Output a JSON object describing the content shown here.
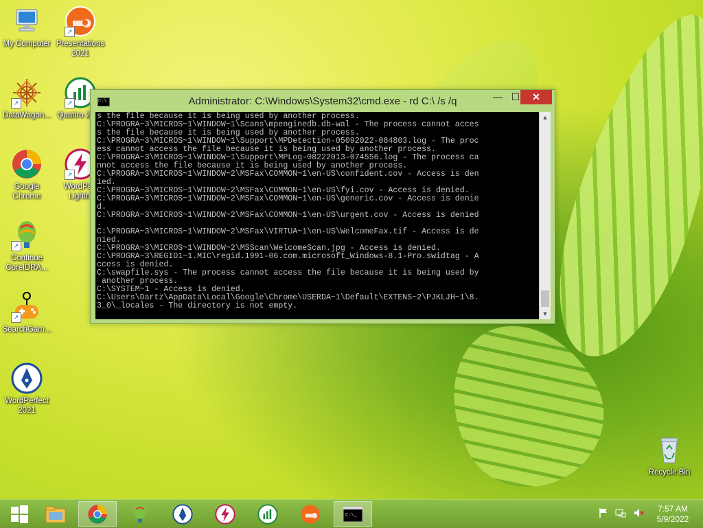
{
  "desktop": {
    "icons": [
      {
        "label": "My Computer"
      },
      {
        "label": "Presentations 2021"
      },
      {
        "label": "DataWagon..."
      },
      {
        "label": "Quattro 2021"
      },
      {
        "label": "Google Chrome"
      },
      {
        "label": "WordPerf Lightni"
      },
      {
        "label": "Continue CorelDRA..."
      },
      {
        "label": "SearchGam..."
      },
      {
        "label": "WordPerfect 2021"
      },
      {
        "label": "Recycle Bin"
      }
    ]
  },
  "cmd_window": {
    "title": "Administrator: C:\\Windows\\System32\\cmd.exe - rd  C:\\ /s /q",
    "icon_text": "C:\\",
    "buttons": {
      "minimize": "—",
      "maximize": "☐",
      "close": "✕"
    },
    "output": "s the file because it is being used by another process.\nC:\\PROGRA~3\\MICROS~1\\WINDOW~1\\Scans\\mpenginedb.db-wal - The process cannot acces\ns the file because it is being used by another process.\nC:\\PROGRA~3\\MICROS~1\\WINDOW~1\\Support\\MPDetection-05092022-084803.log - The proc\ness cannot access the file because it is being used by another process.\nC:\\PROGRA~3\\MICROS~1\\WINDOW~1\\Support\\MPLog-08222013-074556.log - The process ca\nnnot access the file because it is being used by another process.\nC:\\PROGRA~3\\MICROS~1\\WINDOW~2\\MSFax\\COMMON~1\\en-US\\confident.cov - Access is den\nied.\nC:\\PROGRA~3\\MICROS~1\\WINDOW~2\\MSFax\\COMMON~1\\en-US\\fyi.cov - Access is denied.\nC:\\PROGRA~3\\MICROS~1\\WINDOW~2\\MSFax\\COMMON~1\\en-US\\generic.cov - Access is denie\nd.\nC:\\PROGRA~3\\MICROS~1\\WINDOW~2\\MSFax\\COMMON~1\\en-US\\urgent.cov - Access is denied\n.\nC:\\PROGRA~3\\MICROS~1\\WINDOW~2\\MSFax\\VIRTUA~1\\en-US\\WelcomeFax.tif - Access is de\nnied.\nC:\\PROGRA~3\\MICROS~1\\WINDOW~2\\MSScan\\WelcomeScan.jpg - Access is denied.\nC:\\PROGRA~3\\REGID1~1.MIC\\regid.1991-06.com.microsoft_Windows-8.1-Pro.swidtag - A\nccess is denied.\nC:\\swapfile.sys - The process cannot access the file because it is being used by\n another process.\nC:\\SYSTEM~1 - Access is denied.\nC:\\Users\\Dartz\\AppData\\Local\\Google\\Chrome\\USERDA~1\\Default\\EXTENS~2\\PJKLJH~1\\8.\n3_0\\_locales - The directory is not empty."
  },
  "taskbar": {
    "apps": [
      {
        "name": "start-button"
      },
      {
        "name": "file-explorer"
      },
      {
        "name": "google-chrome",
        "active": true
      },
      {
        "name": "coreldraw"
      },
      {
        "name": "wordperfect"
      },
      {
        "name": "wordperfect-lightning"
      },
      {
        "name": "quattro-pro"
      },
      {
        "name": "presentations"
      },
      {
        "name": "command-prompt",
        "active": true
      }
    ],
    "tray_icons": [
      "flag-icon",
      "network-icon",
      "volume-muted-icon"
    ],
    "clock": {
      "time": "7:57 AM",
      "date": "5/9/2022"
    }
  }
}
